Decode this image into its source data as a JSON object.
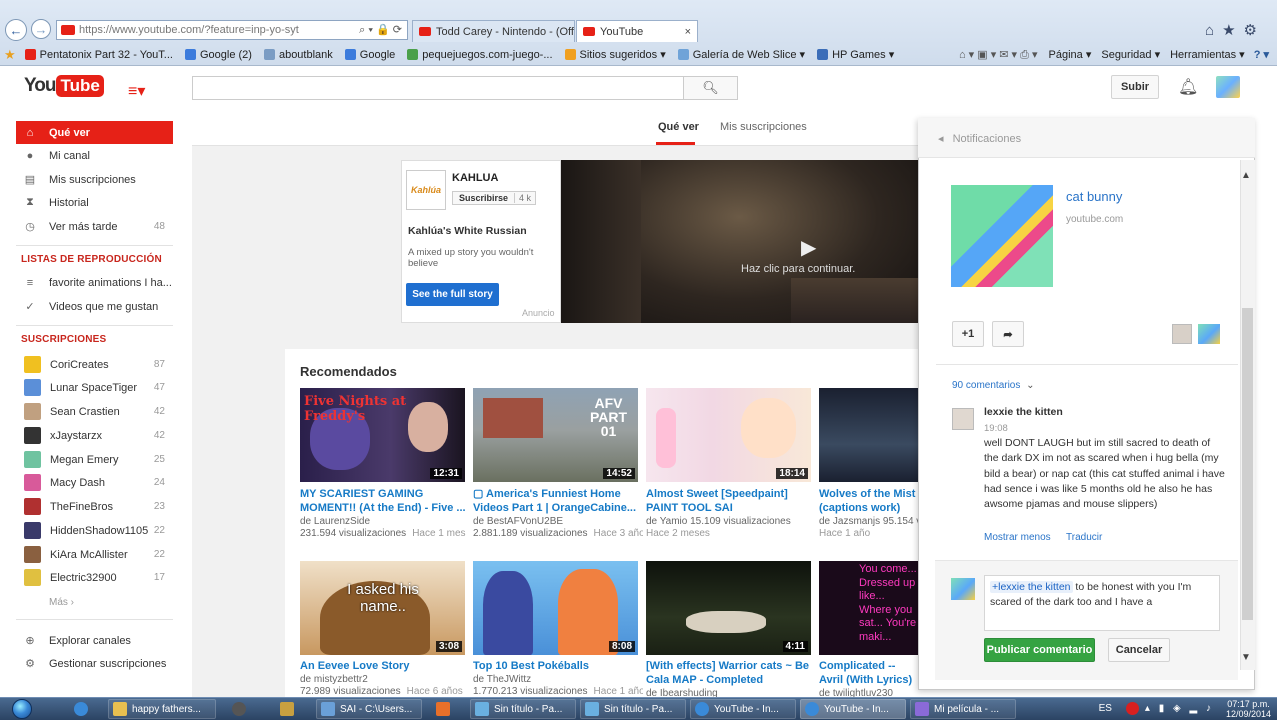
{
  "browser": {
    "address": "https://www.youtube.com/?feature=inp-yo-syt",
    "tabs": [
      {
        "label": "Todd Carey - Nintendo - (Offic..."
      },
      {
        "label": "YouTube"
      }
    ],
    "favorites": [
      {
        "label": "Pentatonix Part 32 - YouT...",
        "color": "#e62117"
      },
      {
        "label": "Google (2)",
        "color": "#3b7bdc"
      },
      {
        "label": "aboutblank",
        "color": "#7a9cc4"
      },
      {
        "label": "Google",
        "color": "#3b7bdc"
      },
      {
        "label": "pequejuegos.com-juego-...",
        "color": "#4aa04a"
      },
      {
        "label": "Sitios sugeridos ▾",
        "color": "#f0a020"
      },
      {
        "label": "Galería de Web Slice ▾",
        "color": "#6fa3d8"
      },
      {
        "label": "HP Games ▾",
        "color": "#3b6db8"
      }
    ],
    "commands": [
      "Página ▾",
      "Seguridad ▾",
      "Herramientas ▾"
    ]
  },
  "header": {
    "logo_you": "You",
    "logo_tube": "Tube",
    "upload_label": "Subir"
  },
  "sidebar": {
    "items": [
      {
        "label": "Qué ver",
        "icon": "home-icon",
        "glyph": "⌂"
      },
      {
        "label": "Mi canal",
        "icon": "user-icon",
        "glyph": "●"
      },
      {
        "label": "Mis suscripciones",
        "icon": "subscriptions-icon",
        "glyph": "▤"
      },
      {
        "label": "Historial",
        "icon": "hourglass-icon",
        "glyph": "⧗"
      },
      {
        "label": "Ver más tarde",
        "icon": "clock-icon",
        "glyph": "◷",
        "count": "48"
      }
    ],
    "playlists_heading": "LISTAS DE REPRODUCCIÓN",
    "playlists": [
      {
        "label": "favorite animations I ha...",
        "glyph": "≡"
      },
      {
        "label": "Videos que me gustan",
        "glyph": "👍"
      }
    ],
    "subs_heading": "SUSCRIPCIONES",
    "subscriptions": [
      {
        "label": "CoriCreates",
        "count": "87",
        "color": "#f0c020"
      },
      {
        "label": "Lunar SpaceTiger",
        "count": "47",
        "color": "#5b8fd8"
      },
      {
        "label": "Sean Crastien",
        "count": "42",
        "color": "#c0a080"
      },
      {
        "label": "xJaystarzx",
        "count": "42",
        "color": "#333333"
      },
      {
        "label": "Megan Emery",
        "count": "25",
        "color": "#6fc3a0"
      },
      {
        "label": "Macy Dash",
        "count": "24",
        "color": "#d85a9a"
      },
      {
        "label": "TheFineBros",
        "count": "23",
        "color": "#b03030"
      },
      {
        "label": "HiddenShadow1105",
        "count": "22",
        "color": "#3a3a6a"
      },
      {
        "label": "KiAra McAllister",
        "count": "22",
        "color": "#8a6040"
      },
      {
        "label": "Electric32900",
        "count": "17",
        "color": "#e0c040"
      }
    ],
    "more_label": "Más ›",
    "footer": [
      {
        "label": "Explorar canales",
        "glyph": "⊕"
      },
      {
        "label": "Gestionar suscripciones",
        "glyph": "⚙"
      }
    ]
  },
  "main": {
    "tabs": [
      {
        "label": "Qué ver"
      },
      {
        "label": "Mis suscripciones"
      }
    ],
    "ad": {
      "brand": "KAHLUA",
      "logo_text": "Kahlúa",
      "subscribe_label": "Suscribirse",
      "subscribe_count": "4 k",
      "title": "Kahlúa's White Russian",
      "description": "A mixed up story you wouldn't believe",
      "cta": "See the full story",
      "anuncio": "Anuncio",
      "video_overlay": "Haz clic para continuar."
    },
    "recommended_heading": "Recomendados",
    "videos": [
      {
        "title": "MY SCARIEST GAMING MOMENT!! (At the End) - Five ...",
        "channel": "de LaurenzSide",
        "views": "231.594 visualizaciones",
        "age": "Hace 1 mes",
        "duration": "12:31",
        "overlay": "Five Nights at Freddy's",
        "bg": "#3a2a5a"
      },
      {
        "title": "▢ America's Funniest Home Videos Part 1 | OrangeCabine...",
        "channel": "de BestAFVonU2BE",
        "views": "2.881.189 visualizaciones",
        "age": "Hace 3 años",
        "duration": "14:52",
        "overlay": "AFV PART 01",
        "bg": "#7a8a9a"
      },
      {
        "title": "Almost Sweet [Speedpaint] PAINT TOOL SAI",
        "channel": "de Yamio",
        "views": "15.109 visualizaciones",
        "age": "Hace 2 meses",
        "duration": "18:14",
        "overlay": "",
        "bg": "#f2d8e4"
      },
      {
        "title": "Wolves of the Mist (captions work)",
        "channel": "de Jazsmanjs",
        "views": "95.154 vi",
        "age": "Hace 1 año",
        "duration": "",
        "overlay": "",
        "bg": "#2a3448"
      },
      {
        "title": "An Eevee Love Story",
        "channel": "de mistyzbettr2",
        "views": "72.989 visualizaciones",
        "age": "Hace 6 años",
        "duration": "3:08",
        "overlay": "I asked his name..",
        "bg": "#b08048"
      },
      {
        "title": "Top 10 Best Pokéballs",
        "channel": "de TheJWittz",
        "views": "1.770.213 visualizaciones",
        "age": "Hace 1 año",
        "duration": "8:08",
        "overlay": "",
        "bg": "#5aa0e0"
      },
      {
        "title": "[With effects] Warrior cats ~ Be Cala MAP - Completed",
        "channel": "de Ibearshuding",
        "views": "",
        "age": "",
        "duration": "4:11",
        "overlay": "",
        "bg": "#1e2418"
      },
      {
        "title": "Complicated -- Avril (With Lyrics)",
        "channel": "de twilightluv230",
        "views": "",
        "age": "",
        "duration": "",
        "overlay": "You come... Dressed up like... Where you sat... You're maki...",
        "bg": "#1a0a1a"
      }
    ]
  },
  "notifications": {
    "heading": "Notificaciones",
    "post_title": "cat bunny",
    "post_source": "youtube.com",
    "plus_one": "+1",
    "comments_count": "90 comentarios",
    "comment": {
      "author": "lexxie the kitten",
      "time": "19:08",
      "text": "well DONT LAUGH but im still sacred to death of the dark DX im not as scared when i hug bella (my bild a bear) or nap cat (this cat stuffed animal i have had sence i was like 5 months old he also he has  awsome pjamas and mouse slippers)",
      "show_less": "Mostrar menos",
      "translate": "Traducir"
    },
    "reply": {
      "mention": "+lexxie the kitten",
      "text": " to be honest with you I'm scared of the dark too and I have a"
    },
    "post_comment": "Publicar comentario",
    "cancel": "Cancelar"
  },
  "taskbar": {
    "items": [
      {
        "label": "happy fathers...",
        "color": "#e8c050"
      },
      {
        "label": "",
        "color": "#555555"
      },
      {
        "label": "",
        "color": "#c8a040"
      },
      {
        "label": "SAI - C:\\Users...",
        "color": "#6aa0d8"
      },
      {
        "label": "",
        "color": "#e8702a"
      },
      {
        "label": "Sin título - Pa...",
        "color": "#6ab0e0"
      },
      {
        "label": "Sin título - Pa...",
        "color": "#6ab0e0"
      },
      {
        "label": "YouTube - In...",
        "color": "#3a8ad8"
      },
      {
        "label": "YouTube - In...",
        "color": "#3a8ad8"
      },
      {
        "label": "Mi película - ...",
        "color": "#8a6ad8"
      }
    ],
    "lang": "ES",
    "time": "07:17 p.m.",
    "date": "12/09/2014"
  }
}
